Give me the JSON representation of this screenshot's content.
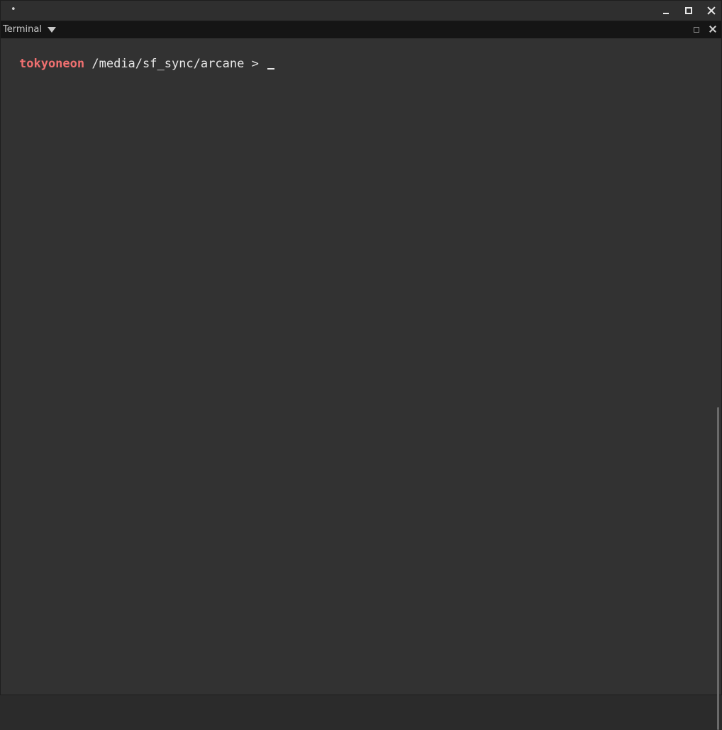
{
  "window": {
    "title": "•"
  },
  "panel": {
    "title": "Terminal"
  },
  "terminal": {
    "user": "tokyoneon",
    "path": "/media/sf_sync/arcane",
    "prompt_symbol": ">"
  },
  "colors": {
    "background": "#323232",
    "panel_header": "#151515",
    "prompt_user": "#f07070",
    "text": "#e6e6e6"
  }
}
